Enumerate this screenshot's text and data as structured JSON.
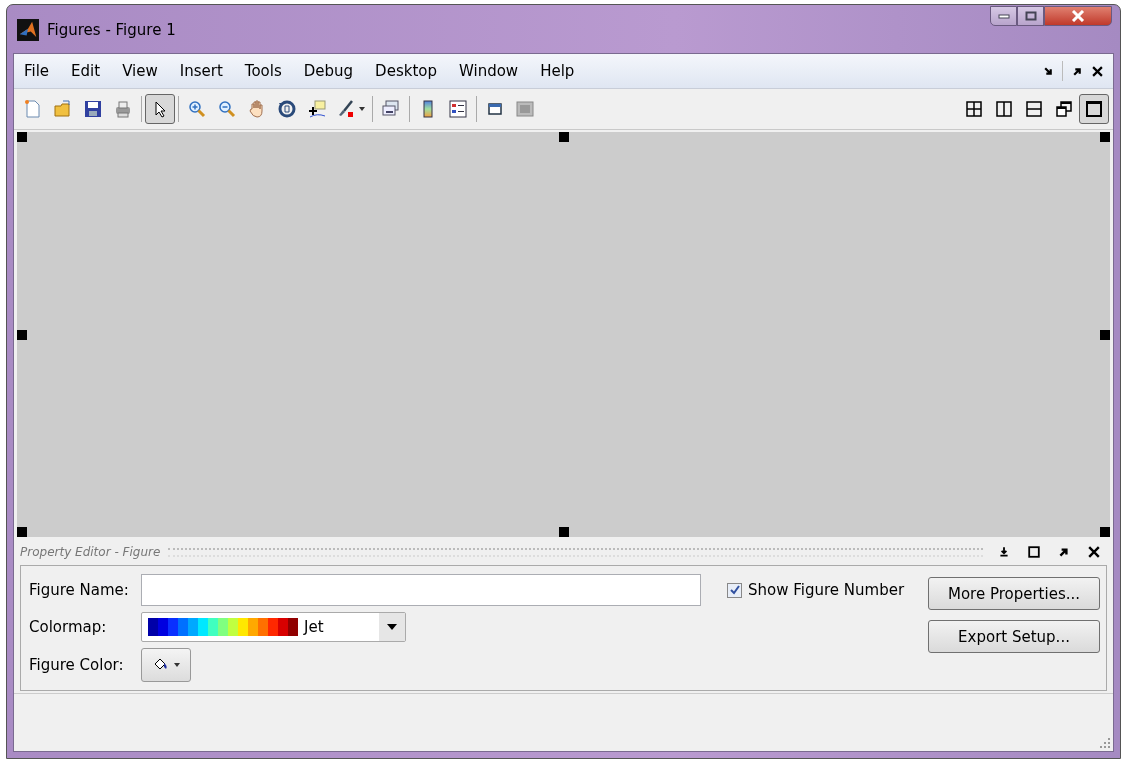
{
  "window": {
    "title": "Figures - Figure 1"
  },
  "menu": [
    "File",
    "Edit",
    "View",
    "Insert",
    "Tools",
    "Debug",
    "Desktop",
    "Window",
    "Help"
  ],
  "toolbar": {
    "groups": [
      [
        {
          "kind": "new",
          "selected": false
        },
        {
          "kind": "open",
          "selected": false
        },
        {
          "kind": "save",
          "selected": false
        },
        {
          "kind": "print",
          "selected": false
        }
      ],
      [
        {
          "kind": "pointer",
          "selected": true
        }
      ],
      [
        {
          "kind": "zoom-in",
          "selected": false
        },
        {
          "kind": "zoom-out",
          "selected": false
        },
        {
          "kind": "pan",
          "selected": false
        },
        {
          "kind": "rotate",
          "selected": false
        },
        {
          "kind": "data-cursor",
          "selected": false
        },
        {
          "kind": "brush",
          "selected": false
        }
      ],
      [
        {
          "kind": "link",
          "selected": false
        }
      ],
      [
        {
          "kind": "colorbar",
          "selected": false
        },
        {
          "kind": "legend",
          "selected": false
        }
      ],
      [
        {
          "kind": "plot-tools-hide",
          "selected": false
        },
        {
          "kind": "plot-tools-show",
          "selected": false
        }
      ]
    ],
    "layouts": [
      {
        "kind": "grid",
        "selected": false
      },
      {
        "kind": "columns",
        "selected": false
      },
      {
        "kind": "rows",
        "selected": false
      },
      {
        "kind": "float",
        "selected": false
      },
      {
        "kind": "single",
        "selected": true
      }
    ]
  },
  "property_editor": {
    "title": "Property Editor - Figure",
    "figure_name": {
      "label": "Figure Name:"
    },
    "show_figure_number": {
      "label": "Show Figure Number",
      "checked": true
    },
    "colormap": {
      "label": "Colormap:",
      "value": "Jet"
    },
    "figure_color": {
      "label": "Figure Color:"
    },
    "buttons": [
      "More Properties...",
      "Export Setup..."
    ]
  }
}
